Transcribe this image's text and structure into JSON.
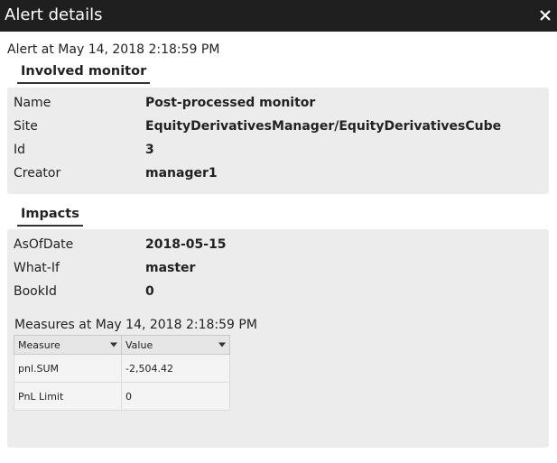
{
  "dialog": {
    "title": "Alert details",
    "alert_at": "Alert at May 14, 2018 2:18:59 PM"
  },
  "involved_monitor": {
    "heading": "Involved monitor",
    "rows": [
      {
        "label": "Name",
        "value": "Post-processed monitor"
      },
      {
        "label": "Site",
        "value": "EquityDerivativesManager/EquityDerivativesCube"
      },
      {
        "label": "Id",
        "value": "3"
      },
      {
        "label": "Creator",
        "value": "manager1"
      }
    ]
  },
  "impacts": {
    "heading": "Impacts",
    "rows": [
      {
        "label": "AsOfDate",
        "value": "2018-05-15"
      },
      {
        "label": "What-If",
        "value": "master"
      },
      {
        "label": "BookId",
        "value": "0"
      }
    ],
    "measures_title": "Measures at May 14, 2018 2:18:59 PM",
    "table": {
      "headers": [
        "Measure",
        "Value"
      ],
      "rows": [
        [
          "pnl.SUM",
          "-2,504.42"
        ],
        [
          "PnL Limit",
          "0"
        ]
      ]
    }
  },
  "icons": {
    "close": "close-icon",
    "sort": "caret-down-icon"
  },
  "colors": {
    "titlebar": "#1f1f1f",
    "panel": "#ececec"
  }
}
